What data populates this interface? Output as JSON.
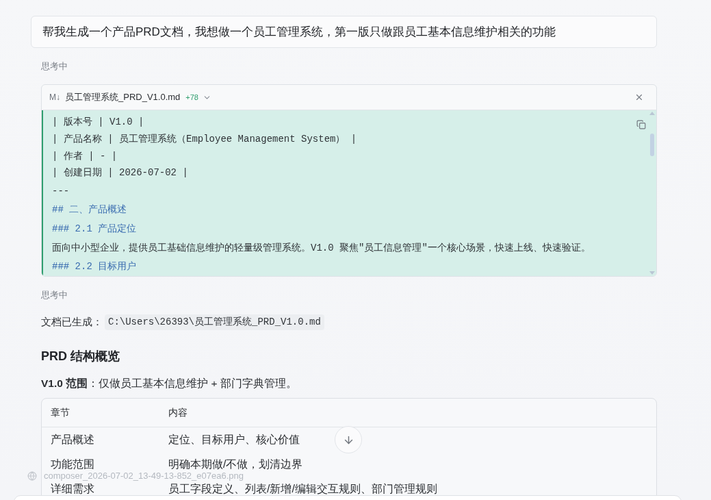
{
  "prompt": {
    "text": "帮我生成一个产品PRD文档，我想做一个员工管理系统，第一版只做跟员工基本信息维护相关的功能"
  },
  "status_first": {
    "text": "思考中"
  },
  "file_panel": {
    "file_type": "M↓",
    "filename": "员工管理系统_PRD_V1.0.md",
    "added": "+78",
    "lines": [
      {
        "kind": "table_row",
        "text": "| 版本号 | V1.0 |"
      },
      {
        "kind": "table_row",
        "text": "| 产品名称 | 员工管理系统（Employee Management System） |"
      },
      {
        "kind": "table_row",
        "text": "| 作者 | - |"
      },
      {
        "kind": "table_row",
        "text": "| 创建日期 | 2026-07-02 |"
      },
      {
        "kind": "rule",
        "text": "---"
      },
      {
        "kind": "heading",
        "text": "## 二、产品概述"
      },
      {
        "kind": "heading",
        "text": "### 2.1 产品定位"
      },
      {
        "kind": "paragraph",
        "text": "面向中小型企业，提供员工基础信息维护的轻量级管理系统。V1.0 聚焦\"员工信息管理\"一个核心场景，快速上线、快速验证。"
      },
      {
        "kind": "heading",
        "text": "### 2.2 目标用户"
      }
    ]
  },
  "status_second": {
    "text": "思考中"
  },
  "result": {
    "label": "文档已生成：",
    "path": "C:\\Users\\26393\\员工管理系统_PRD_V1.0.md"
  },
  "section_heading": "PRD 结构概览",
  "scope": "**V1.0 范围**：仅做员工基本信息维护 + 部门字典管理。",
  "table": {
    "columns": [
      "章节",
      "内容"
    ],
    "rows": [
      [
        "产品概述",
        "定位、目标用户、核心价值"
      ],
      [
        "功能范围",
        "明确本期做/不做，划清边界"
      ],
      [
        "详细需求",
        "员工字段定义、列表/新增/编辑交互规则、部门管理规则"
      ]
    ]
  },
  "attachment": {
    "filename": "composer_2026-07-02_13-49-13-852_e07ea6.png"
  }
}
